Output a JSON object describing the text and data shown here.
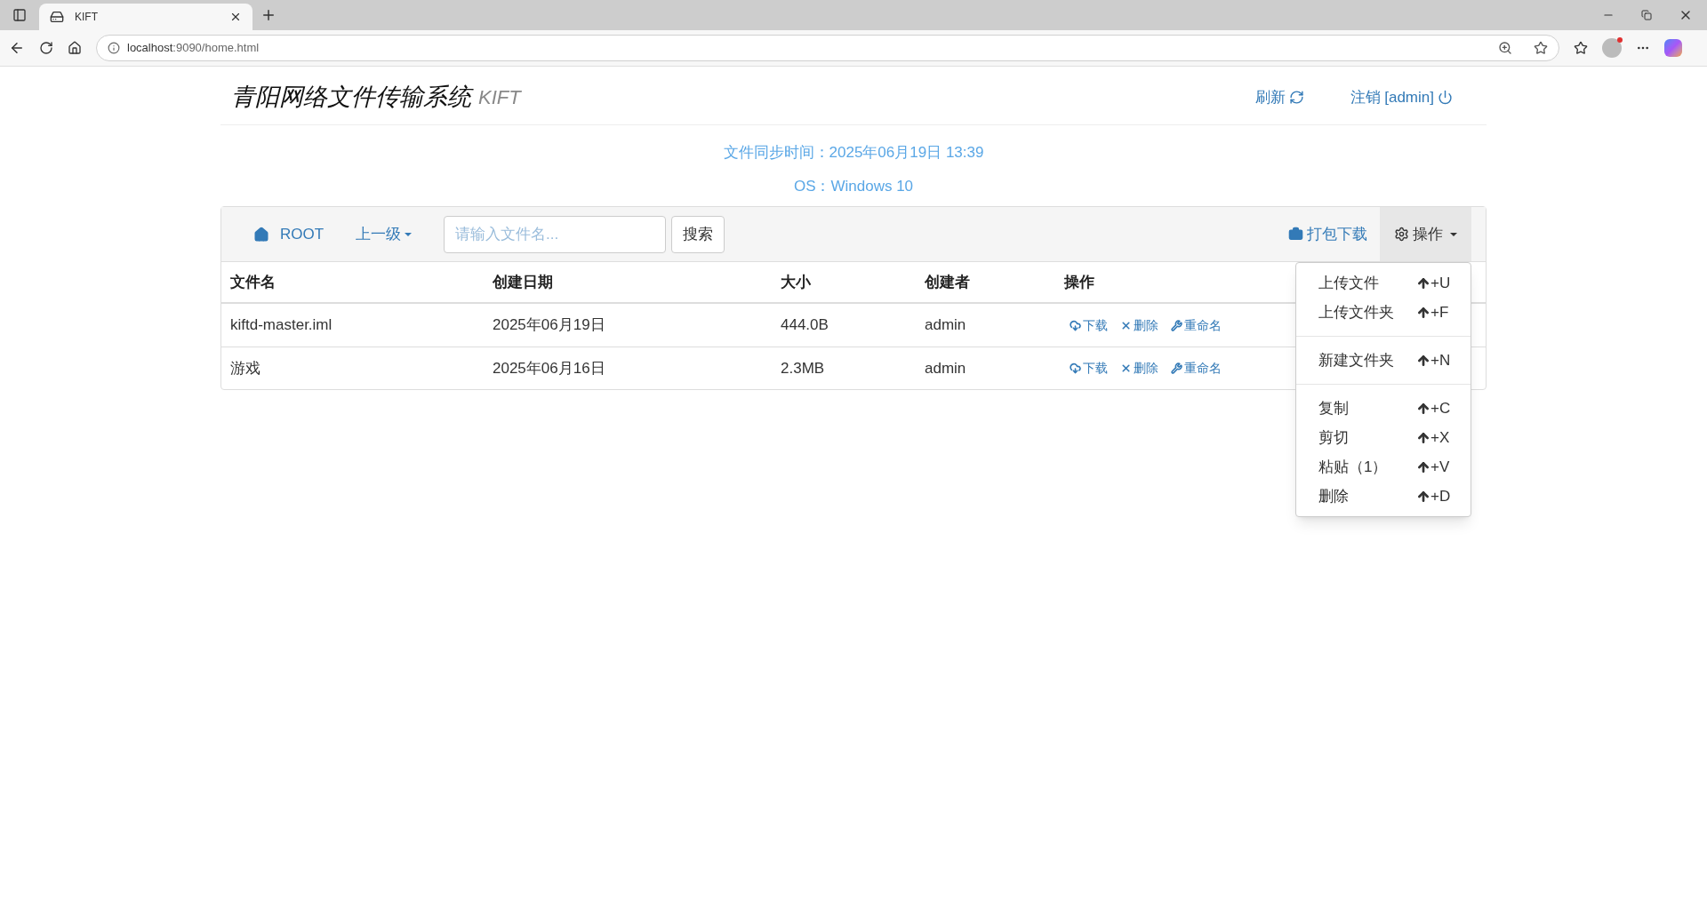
{
  "browser": {
    "tab_title": "KIFT",
    "url_host": "localhost",
    "url_rest": ":9090/home.html"
  },
  "header": {
    "title": "青阳网络文件传输系统",
    "subtitle": "KIFT",
    "refresh": "刷新",
    "logout": "注销 [admin]"
  },
  "info": [
    "文件同步时间：2025年06月19日 13:39",
    "OS：Windows 10"
  ],
  "toolbar": {
    "root": "ROOT",
    "parent": "上一级",
    "search_placeholder": "请输入文件名...",
    "search_button": "搜索",
    "pack_download": "打包下载",
    "operations": "操作"
  },
  "table": {
    "columns": [
      "文件名",
      "创建日期",
      "大小",
      "创建者",
      "操作"
    ],
    "rows": [
      {
        "name": "kiftd-master.iml",
        "date": "2025年06月19日",
        "size": "444.0B",
        "creator": "admin",
        "actions": [
          "下载",
          "删除",
          "重命名"
        ]
      },
      {
        "name": "游戏",
        "date": "2025年06月16日",
        "size": "2.3MB",
        "creator": "admin",
        "actions": [
          "下载",
          "删除",
          "重命名"
        ]
      }
    ]
  },
  "menu": {
    "groups": [
      [
        {
          "label": "上传文件",
          "shortcut": "+U"
        },
        {
          "label": "上传文件夹",
          "shortcut": "+F"
        }
      ],
      [
        {
          "label": "新建文件夹",
          "shortcut": "+N"
        }
      ],
      [
        {
          "label": "复制",
          "shortcut": "+C"
        },
        {
          "label": "剪切",
          "shortcut": "+X"
        },
        {
          "label": "粘贴（1）",
          "shortcut": "+V"
        },
        {
          "label": "删除",
          "shortcut": "+D"
        }
      ]
    ]
  }
}
